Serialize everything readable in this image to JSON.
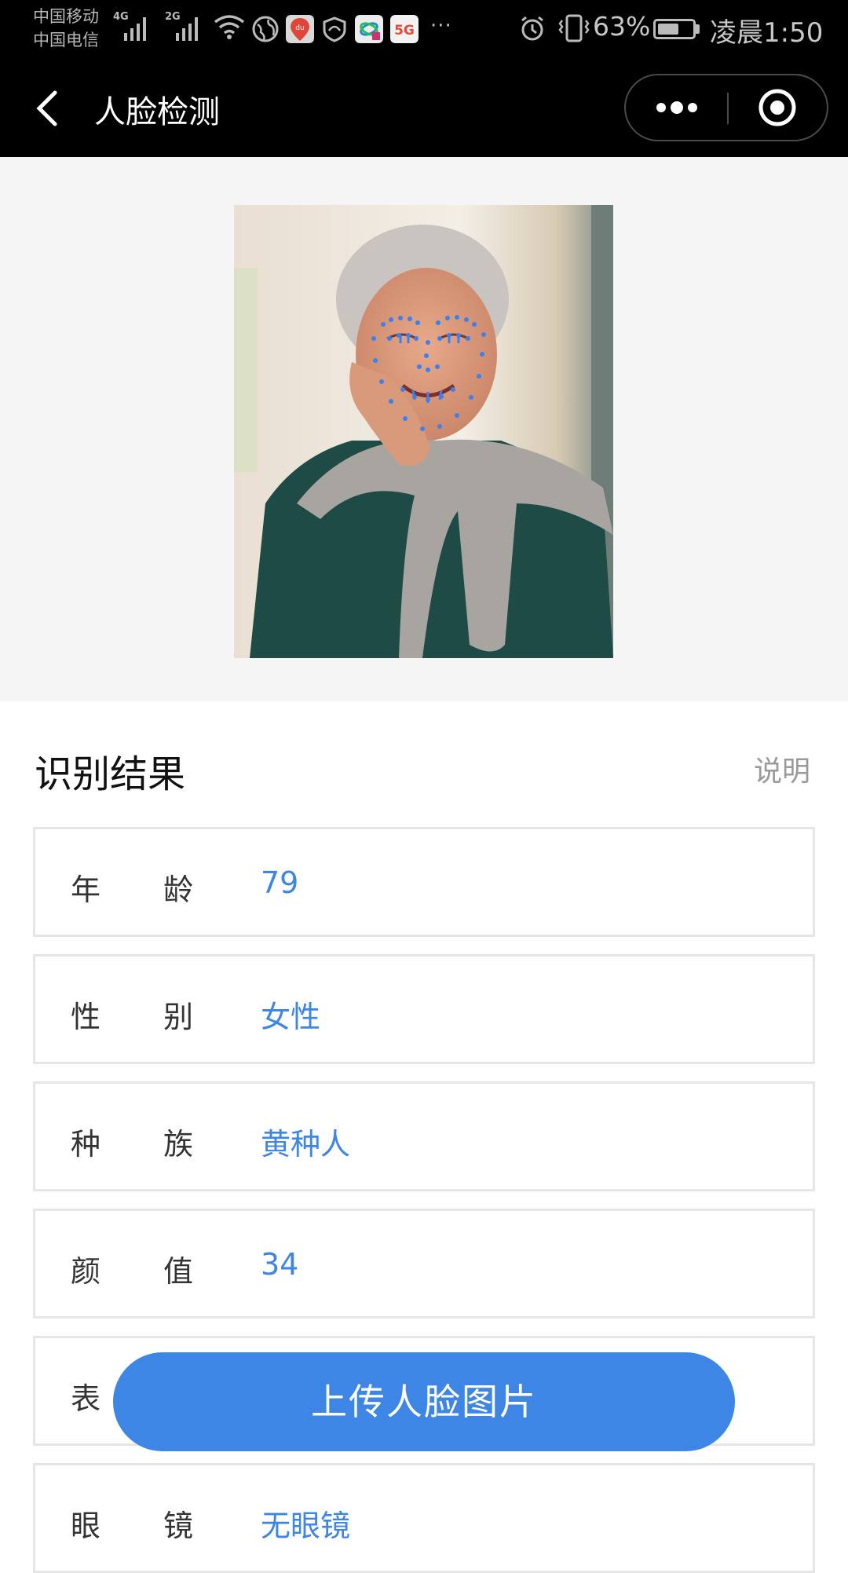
{
  "status_bar": {
    "carrier_1": "中国移动",
    "carrier_2": "中国电信",
    "signal_1_tag": "4G",
    "signal_2_tag": "2G",
    "app_icons": [
      "globe-icon",
      "baidu-map-icon",
      "shield-icon",
      "china-mobile-icon",
      "5g-icon"
    ],
    "overflow": "···",
    "battery_pct": "63%",
    "battery_level": 0.63,
    "time": "凌晨1:50"
  },
  "nav": {
    "title": "人脸检测"
  },
  "results": {
    "title": "识别结果",
    "help_link": "说明",
    "rows": [
      {
        "k1": "年",
        "k2": "龄",
        "value": "79"
      },
      {
        "k1": "性",
        "k2": "别",
        "value": "女性"
      },
      {
        "k1": "种",
        "k2": "族",
        "value": "黄种人"
      },
      {
        "k1": "颜",
        "k2": "值",
        "value": "34"
      },
      {
        "k1": "表",
        "k2": "",
        "value": ""
      },
      {
        "k1": "眼",
        "k2": "镜",
        "value": "无眼镜"
      }
    ]
  },
  "upload_button": "上传人脸图片",
  "colors": {
    "accent": "#3d86e6",
    "landmark_dots": "#3b7ff0",
    "top_bar": "#000000",
    "photo_bg": "#f5f5f5"
  }
}
